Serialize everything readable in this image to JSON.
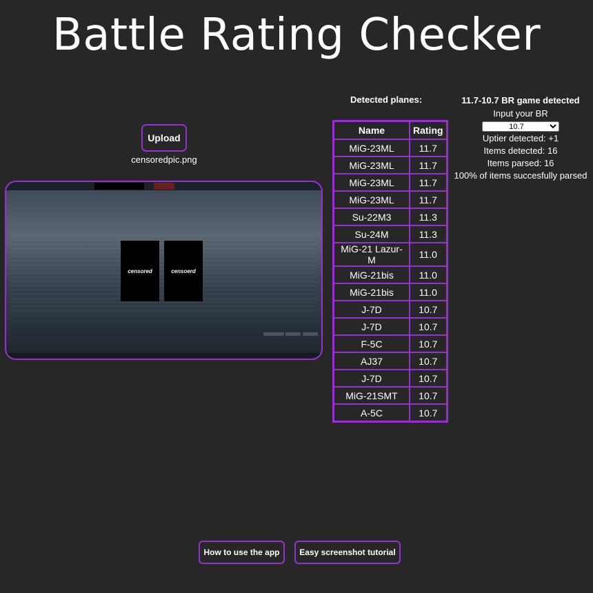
{
  "page": {
    "title": "Battle Rating Checker"
  },
  "upload": {
    "button_label": "Upload",
    "file_name": "censoredpic.png"
  },
  "preview": {
    "panel_left": "censored",
    "panel_right": "censoerd"
  },
  "detected": {
    "heading": "Detected planes:",
    "columns": {
      "name": "Name",
      "rating": "Rating"
    },
    "rows": [
      {
        "name": "MiG-23ML",
        "rating": "11.7"
      },
      {
        "name": "MiG-23ML",
        "rating": "11.7"
      },
      {
        "name": "MiG-23ML",
        "rating": "11.7"
      },
      {
        "name": "MiG-23ML",
        "rating": "11.7"
      },
      {
        "name": "Su-22M3",
        "rating": "11.3"
      },
      {
        "name": "Su-24M",
        "rating": "11.3"
      },
      {
        "name": "MiG-21 Lazur-M",
        "rating": "11.0"
      },
      {
        "name": "MiG-21bis",
        "rating": "11.0"
      },
      {
        "name": "MiG-21bis",
        "rating": "11.0"
      },
      {
        "name": "J-7D",
        "rating": "10.7"
      },
      {
        "name": "J-7D",
        "rating": "10.7"
      },
      {
        "name": "F-5C",
        "rating": "10.7"
      },
      {
        "name": "AJ37",
        "rating": "10.7"
      },
      {
        "name": "J-7D",
        "rating": "10.7"
      },
      {
        "name": "MiG-21SMT",
        "rating": "10.7"
      },
      {
        "name": "A-5C",
        "rating": "10.7"
      }
    ]
  },
  "info": {
    "game_detected": "11.7-10.7 BR game detected",
    "input_label": "Input your BR",
    "br_selected": "10.7",
    "uptier": "Uptier detected: +1",
    "items_detected": "Items detected: 16",
    "items_parsed": "Items parsed: 16",
    "parse_rate": "100% of items succesfully parsed"
  },
  "footer": {
    "how_to_label": "How to use the app",
    "tutorial_label": "Easy screenshot tutorial"
  },
  "colors": {
    "accent": "#9a2fd0",
    "background": "#272727",
    "text": "#ffffff"
  }
}
